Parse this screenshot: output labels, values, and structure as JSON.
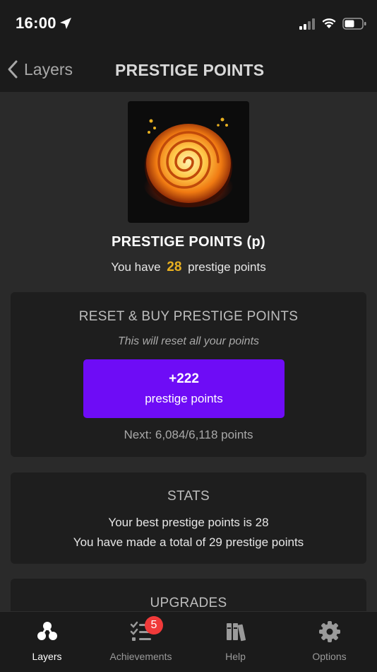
{
  "status_bar": {
    "time": "16:00",
    "icons": [
      "location-arrow-icon",
      "cellular-signal-icon",
      "wifi-icon",
      "battery-icon"
    ]
  },
  "nav": {
    "back_label": "Layers",
    "title": "PRESTIGE POINTS"
  },
  "layer": {
    "image_icon": "prestige-spiral-icon",
    "name": "PRESTIGE POINTS (p)",
    "have_prefix": "You have",
    "have_count": "28",
    "have_suffix": "prestige points",
    "accent_color": "#e8b020"
  },
  "reset_card": {
    "title": "RESET & BUY PRESTIGE POINTS",
    "note": "This will reset all your points",
    "button_amount": "+222",
    "button_unit": "prestige points",
    "button_color": "#6e0cf6",
    "next": "Next: 6,084/6,118 points"
  },
  "stats_card": {
    "title": "STATS",
    "best": "Your best prestige points is 28",
    "total": "You have made a total of 29 prestige points"
  },
  "upgrades_card": {
    "title": "UPGRADES"
  },
  "tab_bar": {
    "tabs": [
      {
        "label": "Layers",
        "icon": "layers-icon",
        "active": true
      },
      {
        "label": "Achievements",
        "icon": "checklist-icon",
        "badge": "5"
      },
      {
        "label": "Help",
        "icon": "books-icon"
      },
      {
        "label": "Options",
        "icon": "gear-icon"
      }
    ],
    "badge_color": "#f03a3a"
  }
}
